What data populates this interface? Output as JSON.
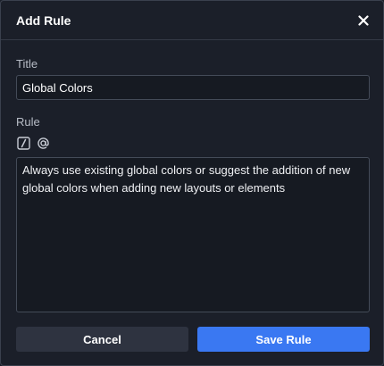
{
  "dialog": {
    "title": "Add Rule",
    "close_icon": "close-icon"
  },
  "title_field": {
    "label": "Title",
    "value": "Global Colors"
  },
  "rule_field": {
    "label": "Rule",
    "toolbar": [
      "slash-command-icon",
      "mention-at-icon"
    ],
    "value": "Always use existing global colors or suggest the addition of new global colors when adding new layouts or elements"
  },
  "actions": {
    "cancel_label": "Cancel",
    "save_label": "Save Rule"
  },
  "colors": {
    "background": "#1b1f29",
    "input_background": "#161a22",
    "primary_button": "#3a78f2",
    "secondary_button": "#2e3340"
  }
}
